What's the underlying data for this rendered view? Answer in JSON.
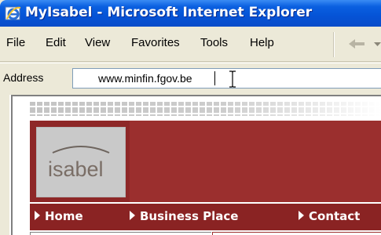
{
  "window": {
    "title": "MyIsabel - Microsoft Internet Explorer",
    "icon": "internet-explorer-icon"
  },
  "menubar": {
    "items": [
      "File",
      "Edit",
      "View",
      "Favorites",
      "Tools",
      "Help"
    ],
    "back_icon": "back-arrow-icon"
  },
  "address": {
    "label": "Address",
    "value": "www.minfin.fgov.be"
  },
  "page": {
    "logo_text": "isabel",
    "nav": [
      "Home",
      "Business Place",
      "Contact"
    ]
  },
  "colors": {
    "titlebar": "#0553d6",
    "banner": "#9b2f2e",
    "navbar": "#8a2323",
    "logo_bg": "#c9c9c9"
  }
}
